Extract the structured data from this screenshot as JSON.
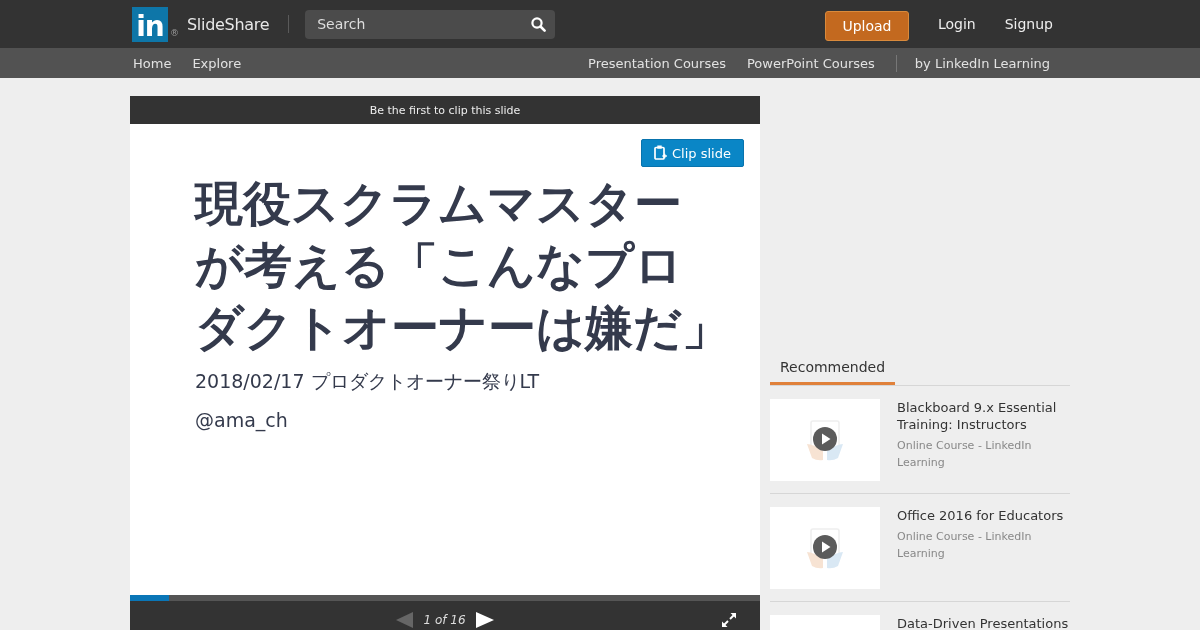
{
  "top_bar": {
    "logo_mark": "in",
    "registered_mark": "®",
    "brand": "SlideShare",
    "search": {
      "placeholder": "Search"
    },
    "actions": [
      {
        "kind": "button",
        "label": "Upload"
      },
      {
        "kind": "link",
        "label": "Login"
      },
      {
        "kind": "link",
        "label": "Signup"
      }
    ]
  },
  "nav_bar": {
    "left_links": [
      "Home",
      "Explore"
    ],
    "right_links": [
      "Presentation Courses",
      "PowerPoint Courses"
    ],
    "partner_link": "by LinkedIn Learning"
  },
  "player": {
    "clip_banner": "Be the first to clip this slide",
    "clip_button": "Clip slide",
    "slide": {
      "title_lines": [
        "現役スクラムマスター",
        "が考える「こんなプロ",
        "ダクトオーナーは嫌だ」"
      ],
      "event": "2018/02/17 プロダクトオーナー祭りLT",
      "author": "@ama_ch"
    },
    "progress": {
      "level": 0.0625
    },
    "controls": {
      "previous": {
        "disabled": true
      },
      "counter": "1 of 16",
      "next": {
        "disabled": false
      }
    }
  },
  "sidebar": {
    "tabs": [
      {
        "label": "Recommended",
        "selected": true
      }
    ],
    "courses": [
      {
        "title": "Blackboard 9.x Essential Training: Instructors",
        "subtitle": "Online Course - LinkedIn Learning"
      },
      {
        "title": "Office 2016 for Educators",
        "subtitle": "Online Course - LinkedIn Learning"
      },
      {
        "title": "Data-Driven Presentations"
      }
    ]
  }
}
